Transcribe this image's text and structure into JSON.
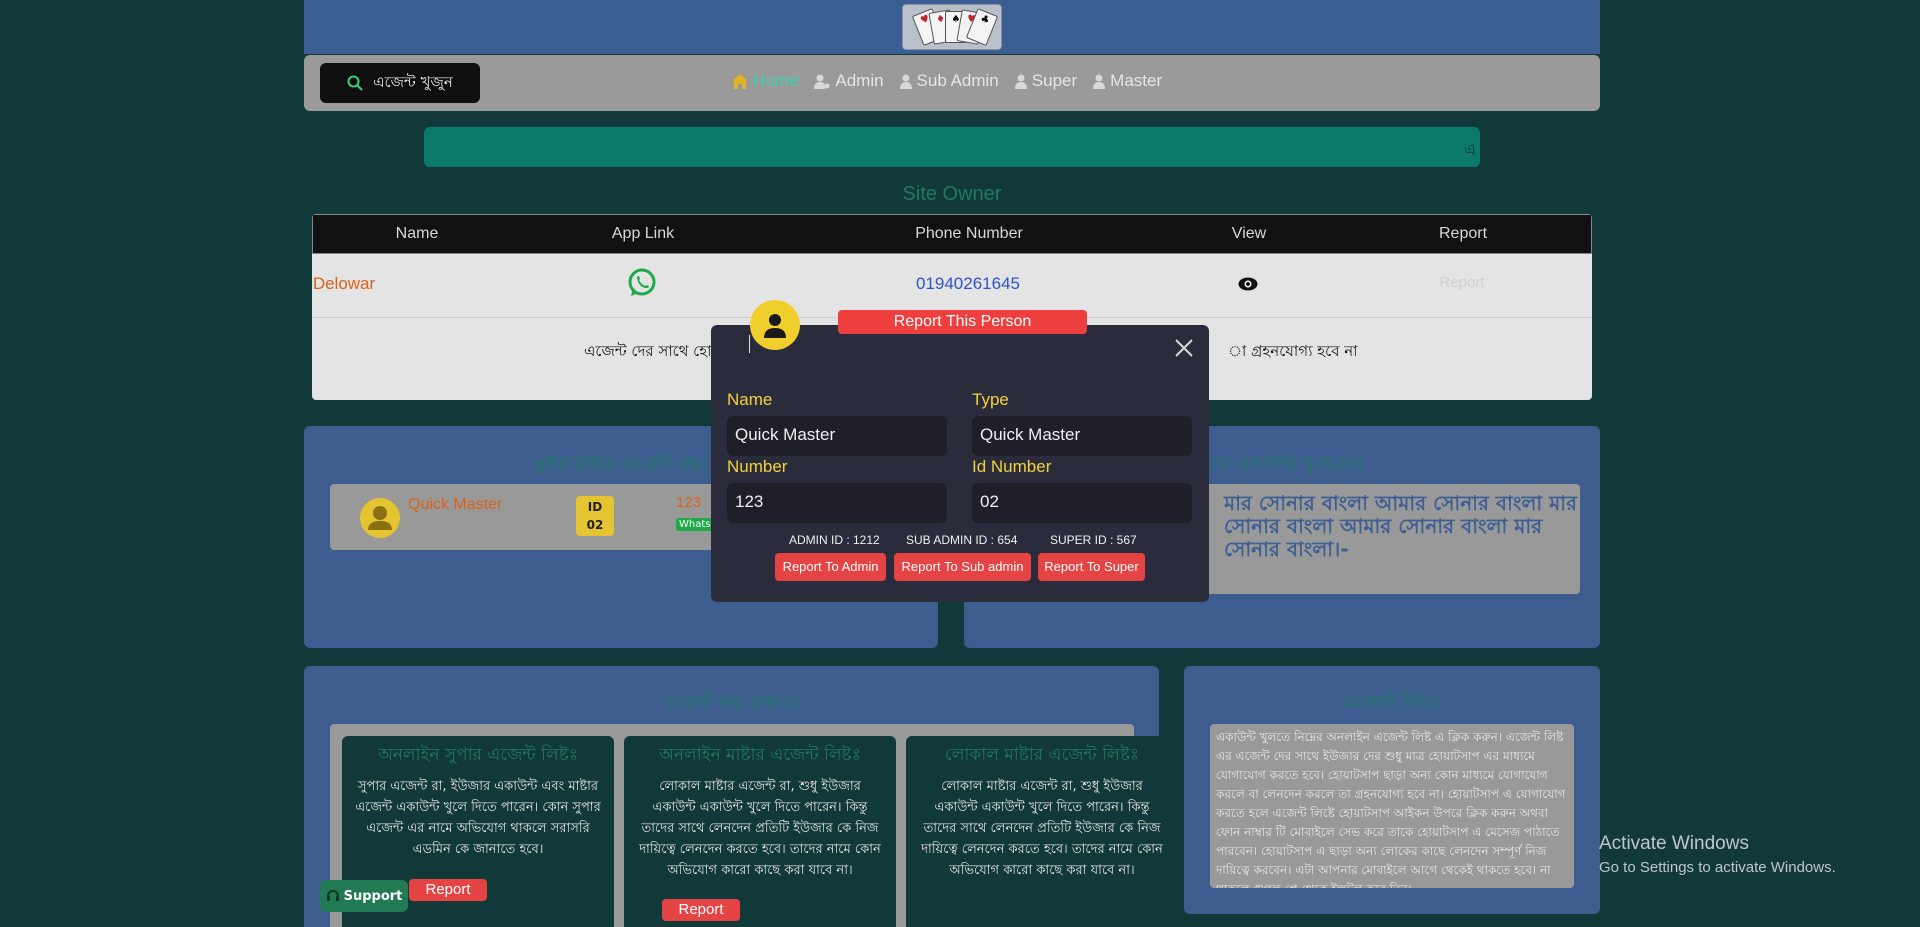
{
  "header": {
    "search_label": "এজেন্ট খুজুন",
    "nav": [
      {
        "label": "Home",
        "icon": "home-icon"
      },
      {
        "label": "Admin",
        "icon": "user-gear-icon"
      },
      {
        "label": "Sub Admin",
        "icon": "user-icon"
      },
      {
        "label": "Super",
        "icon": "user-icon"
      },
      {
        "label": "Master",
        "icon": "user-icon"
      }
    ]
  },
  "marquee_text": "এ",
  "site_owner": {
    "title": "Site Owner",
    "columns": [
      "Name",
      "App Link",
      "Phone Number",
      "View",
      "Report"
    ],
    "row": {
      "name": "Delowar",
      "phone": "01940261645",
      "report": "Report"
    },
    "notice_left": "এজেন্ট দের সাথে হোয়া",
    "notice_right": "া গ্রহনযোগ্য হবে না"
  },
  "quick_master": {
    "title": "কুইক মাষ্টার এজেন্ট নম্বর",
    "name": "Quick Master",
    "id_label": "ID",
    "id_value": "02",
    "number": "123",
    "whatsapp": "Whats"
  },
  "account_panel": {
    "title": "ার একাউন্ট খুলবেনঃ",
    "text": "মার সোনার বাংলা আমার সোনার বাংলা মার সোনার বাংলা আমার সোনার বাংলা মার সোনার বাংলা।-"
  },
  "agent_types": {
    "title": "এজেন্ট কয় প্রকারঃ",
    "cards": [
      {
        "title": "অনলাইন সুপার এজেন্ট লিষ্টঃ",
        "text": "সুপার এজেন্ট রা, ইউজার একাউন্ট এবং মাষ্টার এজেন্ট একাউন্ট খুলে দিতে পারেন। কোন সুপার এজেন্ট এর নামে অভিযোগ থাকলে সরাসরি এডমিন কে জানাতে হবে।",
        "button": "Report"
      },
      {
        "title": "অনলাইন মাষ্টার এজেন্ট লিষ্টঃ",
        "text": "লোকাল মাষ্টার এজেন্ট রা, শুধু ইউজার একাউন্ট একাউন্ট খুলে দিতে পারেন। কিন্তু তাদের সাথে লেনদেন প্রতিটি ইউজার কে নিজ দায়িত্বে লেনদেন করতে হবে। তাদের নামে কোন অভিযোগ কারো কাছে করা যাবে না।",
        "button": "Report"
      },
      {
        "title": "লোকাল মাষ্টার এজেন্ট লিষ্টঃ",
        "text": "লোকাল মাষ্টার এজেন্ট রা, শুধু ইউজার একাউন্ট একাউন্ট খুলে দিতে পারেন। কিন্তু তাদের সাথে লেনদেন প্রতিটি ইউজার কে নিজ দায়িত্বে লেনদেন করতে হবে। তাদের নামে কোন অভিযোগ কারো কাছে করা যাবে না।",
        "button": ""
      }
    ]
  },
  "agent_list": {
    "title": "এজেন্ট লিষ্টঃ",
    "text": "একাউন্ট খুলতে নিম্নের অনলাইন এজেন্ট লিষ্ট এ ক্লিক করুন। এজেন্ট লিষ্ট এর এজেন্ট দের সাথে ইউজার দের শুধু মাত্র হোয়াটসাপ এর মাধ্যমে যোগাযোগ করতে হবে। হোয়াটসাপ ছাড়া অন্য কোন মাধ্যমে যোগাযোগ করলে বা লেনদেন করলে তা গ্রহনযোগ্য হবে না। হোয়াটসাপ এ যোগাযোগ করতে হলে এজেন্ট লিষ্টে হোয়াটসাপ আইকন উপরে ক্লিক করুন অথবা ফোন নাম্বার টি মোবাইলে সেভ করে তাকে হোয়াটসাপ এ মেসেজ পাঠাতে পারবেন। হোয়াটসাপ এ ছাড়া অন্য লোকের কাছে লেনদেন সম্পূর্ণ নিজ দায়িত্বে করবেন। এটা আপনার মোবাইলে আগে থেকেই থাকতে হবে। না থাকলে গুগল প্লে থেকে ইন্সটল করে নিন।"
  },
  "support_label": "Support",
  "activate": {
    "line1": "Activate Windows",
    "line2": "Go to Settings to activate Windows."
  },
  "modal": {
    "title": "Report This Person",
    "name_label": "Name",
    "name_value": "Quick Master",
    "type_label": "Type",
    "type_value": "Quick Master",
    "number_label": "Number",
    "number_value": "123",
    "id_label": "Id Number",
    "id_value": "02",
    "admin_id": "ADMIN ID : 1212",
    "sub_admin_id": "SUB ADMIN ID : 654",
    "super_id": "SUPER ID : 567",
    "btn_admin": "Report To Admin",
    "btn_sub_admin": "Report To Sub admin",
    "btn_super": "Report To Super"
  },
  "colors": {
    "bg": "#12393a",
    "panel": "#3c5d8e",
    "accent": "#38d2b0",
    "danger": "#e64444",
    "gold": "#f2d23c"
  }
}
